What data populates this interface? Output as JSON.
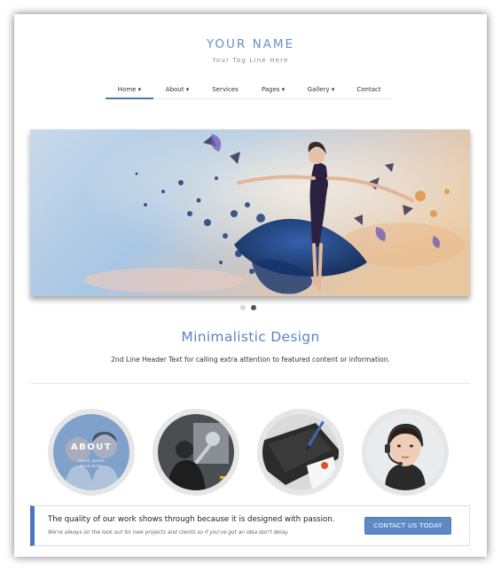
{
  "site": {
    "name": "YOUR NAME",
    "tagline": "Your Tag Line Here"
  },
  "nav": {
    "items": [
      {
        "label": "Home ▾",
        "active": true
      },
      {
        "label": "About ▾",
        "active": false
      },
      {
        "label": "Services",
        "active": false
      },
      {
        "label": "Pages ▾",
        "active": false
      },
      {
        "label": "Gallery ▾",
        "active": false
      },
      {
        "label": "Contact",
        "active": false
      }
    ]
  },
  "slider": {
    "image": "ballet-dancer-particle-art",
    "active_slide": 2,
    "slide_count": 2
  },
  "featured": {
    "headline": "Minimalistic Design",
    "subline": "2nd Line Header Text for calling extra attention to featured content or information."
  },
  "circles": [
    {
      "name": "about-people",
      "label": "ABOUT",
      "sub": "lorem ipsum",
      "sub2": "READ MORE"
    },
    {
      "name": "presentation",
      "label": ""
    },
    {
      "name": "tablet-pen",
      "label": ""
    },
    {
      "name": "support-headset",
      "label": ""
    }
  ],
  "cta": {
    "title": "The quality of our work shows through because it is designed with passion.",
    "text": "We're always on the look out for new projects and clients so if you've got an idea don't delay.",
    "button_label": "CONTACT US TODAY"
  },
  "colors": {
    "accent": "#5b87c0",
    "button": "#5d8ac4",
    "nav_active_underline": "#4a78b5"
  }
}
